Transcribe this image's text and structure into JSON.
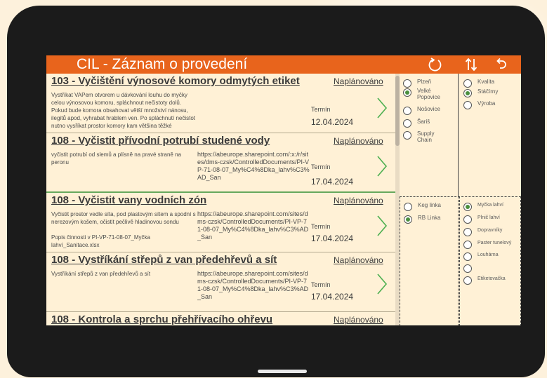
{
  "header": {
    "title": "CIL - Záznam o provedení",
    "icons": [
      "refresh-icon",
      "sort-icon",
      "undo-icon"
    ]
  },
  "tasks": [
    {
      "title": "103 - Vyčištění výnosové komory odmytých etiket",
      "status": "Naplánováno",
      "description": "Vystříkat VAPem otvorem u dávkování louhu do myčky celou výnosovou komoru, spláchnout nečistoty dolů. Pokud bude komora obsahovat větší množství nánosu, ilegitů apod, vyhrabat hrablem ven. Po spláchnutí nečistot nutno vysříkat prostor komory kam většina těžké",
      "link": "",
      "term_label": "Termín",
      "date": "12.04.2024"
    },
    {
      "title": "108 - Vyčistit přívodní potrubí studené vody",
      "status": "Naplánováno",
      "description": "vyčistit potrubí od slemů a plísně na pravé straně na peronu",
      "link": "https://abeurope.sharepoint.com/:x:/r/sites/dms-czsk/ControlledDocuments/PI-VP-71-08-07_My%C4%8Dka_lahv%C3%AD_San",
      "term_label": "Termín",
      "date": "17.04.2024"
    },
    {
      "title": "108 - Vyčistit vany vodních zón",
      "status": "Naplánováno",
      "description": " Vyčistit prostor vedle síta, pod plastovým sítem a spodní s nerezovým košem, očistit pečlivě hladinovou sondu\n\nPopis činnosti v  PI-VP-71-08-07_Myčka lahví_Sanitace.xlsx",
      "link": "https://abeurope.sharepoint.com/sites/dms-czsk/ControlledDocuments/PI-VP-71-08-07_My%C4%8Dka_lahv%C3%AD_San",
      "term_label": "Termín",
      "date": "17.04.2024"
    },
    {
      "title": "108 - Vystříkání střepů z van předehřevů a sít",
      "status": "Naplánováno",
      "description": "Vystříkání střepů z van předehřevů a sít",
      "link": "https://abeurope.sharepoint.com/sites/dms-czsk/ControlledDocuments/PI-VP-71-08-07_My%C4%8Dka_lahv%C3%AD_San",
      "term_label": "Termín",
      "date": "17.04.2024"
    },
    {
      "title": "108 - Kontrola a sprchu přehřívacího ohřevu",
      "status": "Naplánováno",
      "description": "",
      "link": "",
      "term_label": "",
      "date": ""
    }
  ],
  "filters": {
    "plants": [
      {
        "label": "Plzeň",
        "selected": false
      },
      {
        "label": "Velké Popovice",
        "selected": true
      },
      {
        "label": "Nošovice",
        "selected": false
      },
      {
        "label": "Šariš",
        "selected": false
      },
      {
        "label": "Supply Chain",
        "selected": false
      }
    ],
    "areas": [
      {
        "label": "Kvalita",
        "selected": false
      },
      {
        "label": "Stáčírny",
        "selected": true
      },
      {
        "label": "Výroba",
        "selected": false
      }
    ],
    "lines": [
      {
        "label": "Keg linka",
        "selected": false
      },
      {
        "label": "RB Linka",
        "selected": true
      }
    ],
    "machines": [
      {
        "label": "Myčka lahví",
        "selected": true
      },
      {
        "label": "Plnič lahví",
        "selected": false
      },
      {
        "label": "Dopravníky",
        "selected": false
      },
      {
        "label": "Paster tunelový",
        "selected": false
      },
      {
        "label": "Louhárna",
        "selected": false
      },
      {
        "label": "",
        "selected": false
      },
      {
        "label": "Etiketovačka",
        "selected": false
      }
    ]
  },
  "colors": {
    "header": "#e8641c",
    "accent_green": "#4a8f3d",
    "background": "#fff1d6"
  }
}
